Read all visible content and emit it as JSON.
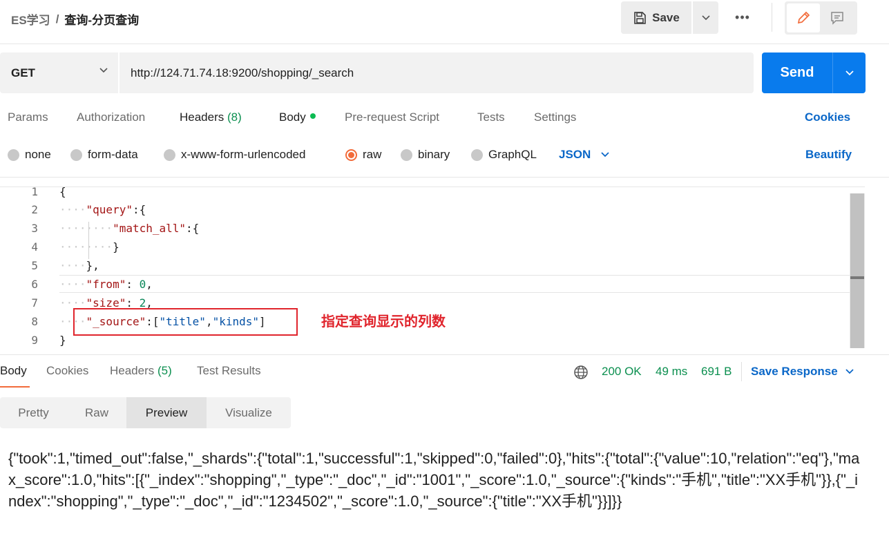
{
  "header": {
    "collection": "ES学习",
    "separator": "/",
    "request_name": "查询-分页查询",
    "save_label": "Save",
    "more_label": "•••"
  },
  "request": {
    "method": "GET",
    "url": "http://124.71.74.18:9200/shopping/_search",
    "send_label": "Send"
  },
  "request_tabs": {
    "params": "Params",
    "authorization": "Authorization",
    "headers": "Headers",
    "headers_count": "(8)",
    "body": "Body",
    "pre_request": "Pre-request Script",
    "tests": "Tests",
    "settings": "Settings",
    "cookies": "Cookies"
  },
  "body_types": {
    "none": "none",
    "form_data": "form-data",
    "urlencoded": "x-www-form-urlencoded",
    "raw": "raw",
    "binary": "binary",
    "graphql": "GraphQL",
    "format": "JSON",
    "beautify": "Beautify",
    "selected": "raw"
  },
  "editor": {
    "line_numbers": [
      "1",
      "2",
      "3",
      "4",
      "5",
      "6",
      "7",
      "8",
      "9"
    ],
    "tokens": {
      "open_brace": "{",
      "query_key": "\"query\"",
      "colon_brace": ":{",
      "match_all_key": "\"match_all\"",
      "close_brace": "}",
      "close_brace_comma": "},",
      "from_key": "\"from\"",
      "from_value": "0",
      "size_key": "\"size\"",
      "size_value": "2",
      "source_key": "\"_source\"",
      "source_open": ":[",
      "title_str": "\"title\"",
      "comma": ",",
      "kinds_str": "\"kinds\"",
      "source_close": "]",
      "colon_space": ": "
    },
    "annotation": "指定查询显示的列数"
  },
  "response_tabs": {
    "body": "Body",
    "cookies": "Cookies",
    "headers": "Headers",
    "headers_count": "(5)",
    "test_results": "Test Results"
  },
  "response_status": {
    "status": "200 OK",
    "time": "49 ms",
    "size": "691 B",
    "save_response": "Save Response"
  },
  "view_modes": {
    "pretty": "Pretty",
    "raw": "Raw",
    "preview": "Preview",
    "visualize": "Visualize",
    "selected": "Preview"
  },
  "response_body": "{\"took\":1,\"timed_out\":false,\"_shards\":{\"total\":1,\"successful\":1,\"skipped\":0,\"failed\":0},\"hits\":{\"total\":{\"value\":10,\"relation\":\"eq\"},\"max_score\":1.0,\"hits\":[{\"_index\":\"shopping\",\"_type\":\"_doc\",\"_id\":\"1001\",\"_score\":1.0,\"_source\":{\"kinds\":\"手机\",\"title\":\"XX手机\"}},{\"_index\":\"shopping\",\"_type\":\"_doc\",\"_id\":\"1234502\",\"_score\":1.0,\"_source\":{\"title\":\"XX手机\"}}]}}",
  "colors": {
    "accent_blue": "#097bed",
    "link_blue": "#0a67c8",
    "status_green": "#0b8f4f",
    "active_orange": "#f26b3a",
    "annotation_red": "#e0242c"
  }
}
